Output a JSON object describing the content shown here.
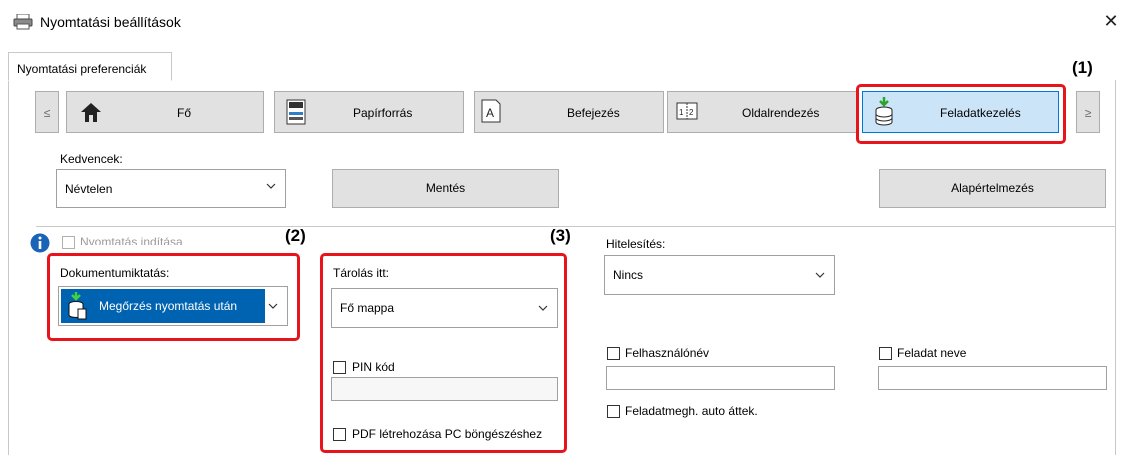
{
  "window": {
    "title": "Nyomtatási beállítások",
    "close": "✕"
  },
  "tab": {
    "label": "Nyomtatási preferenciák"
  },
  "nav": {
    "prev": "≤",
    "next": "≥",
    "buttons": [
      {
        "label": "Fő",
        "icon": "home-icon"
      },
      {
        "label": "Papírforrás",
        "icon": "printer-tray-icon"
      },
      {
        "label": "Befejezés",
        "icon": "finishing-icon"
      },
      {
        "label": "Oldalrendezés",
        "icon": "page-layout-icon"
      },
      {
        "label": "Feladatkezelés",
        "icon": "job-handling-icon",
        "selected": true
      }
    ]
  },
  "callouts": {
    "c1": "(1)",
    "c2": "(2)",
    "c3": "(3)"
  },
  "favorites": {
    "label": "Kedvencek:",
    "value": "Névtelen",
    "save": "Mentés",
    "defaults": "Alapértelmezés"
  },
  "print_start": {
    "label": "Nyomtatás indítása",
    "checked": false,
    "disabled": true
  },
  "retention": {
    "label": "Dokumentumiktatás:",
    "value": "Megőrzés nyomtatás után"
  },
  "store": {
    "label": "Tárolás itt:",
    "value": "Fő mappa",
    "pin_label": "PIN kód",
    "pin_value": "",
    "pdf_label": "PDF létrehozása PC böngészéshez"
  },
  "auth": {
    "label": "Hitelesítés:",
    "value": "Nincs",
    "username_label": "Felhasználónév",
    "username_value": "",
    "jobname_label": "Feladat neve",
    "jobname_value": "",
    "auto_label": "Feladatmegh. auto áttek."
  },
  "colors": {
    "accent_red": "#e8141b",
    "selected_bg": "#cce4f7",
    "selected_border": "#0078d7",
    "retention_bg": "#0063b1"
  }
}
